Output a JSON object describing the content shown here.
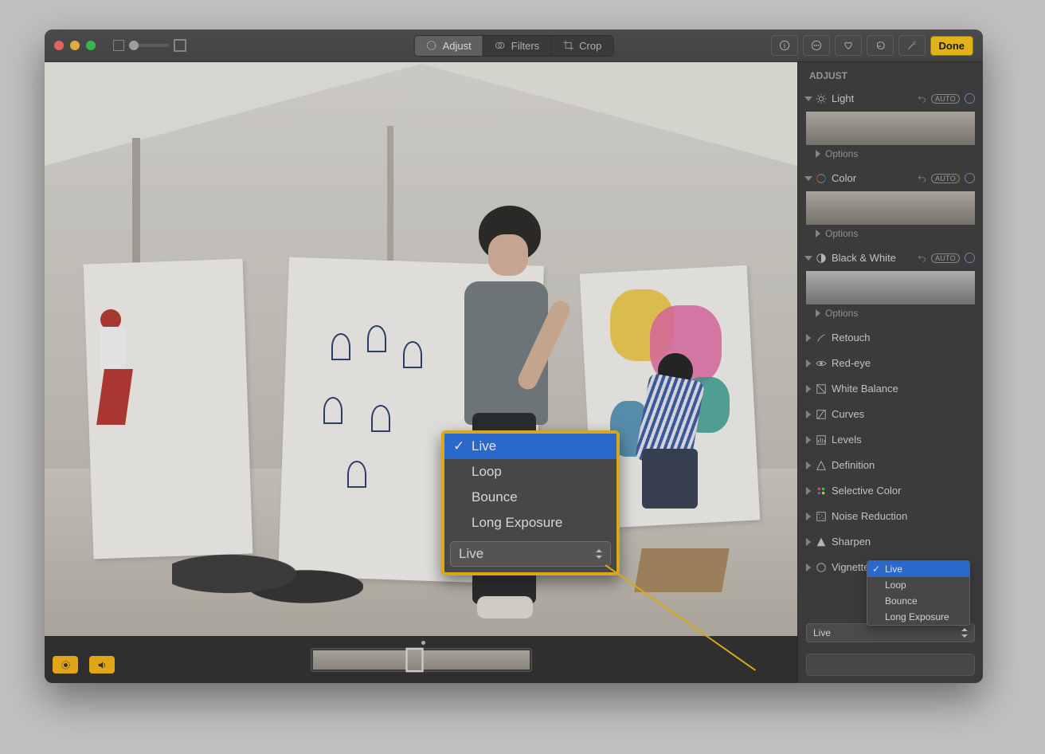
{
  "toolbar": {
    "tabs": {
      "adjust": "Adjust",
      "filters": "Filters",
      "crop": "Crop"
    },
    "done_label": "Done"
  },
  "live": {
    "options": [
      "Live",
      "Loop",
      "Bounce",
      "Long Exposure"
    ],
    "selected": "Live",
    "dropdown_value": "Live"
  },
  "sidebar": {
    "header": "ADJUST",
    "auto_label": "AUTO",
    "options_label": "Options",
    "panels": {
      "light": "Light",
      "color": "Color",
      "bw": "Black & White",
      "retouch": "Retouch",
      "redeye": "Red-eye",
      "wb": "White Balance",
      "curves": "Curves",
      "levels": "Levels",
      "definition": "Definition",
      "selective": "Selective Color",
      "noise": "Noise Reduction",
      "sharpen": "Sharpen",
      "vignette": "Vignette"
    },
    "dropdown_value": "Live"
  }
}
